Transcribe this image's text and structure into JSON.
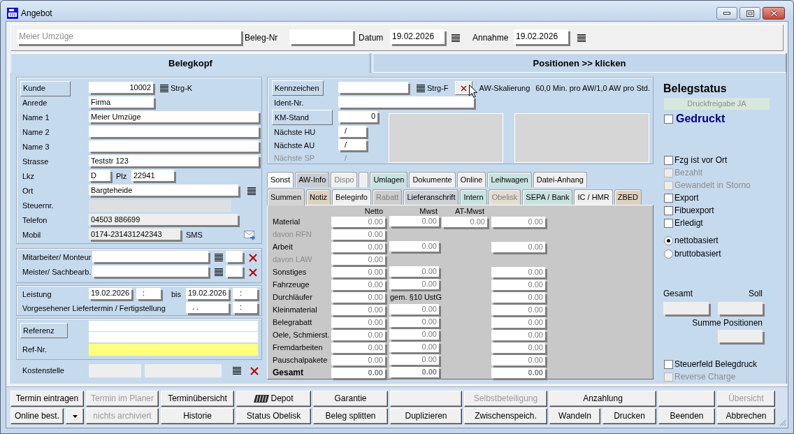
{
  "window": {
    "title": "Angebot"
  },
  "header": {
    "customer_name": {
      "value": "Meier Umzüge",
      "disabled": true
    },
    "beleg_nr": {
      "label": "Beleg-Nr"
    },
    "datum": {
      "label": "Datum",
      "value": "19.02.2026"
    },
    "annahme": {
      "label": "Annahme",
      "value": "19.02.2026"
    }
  },
  "main_tabs": [
    {
      "label": "Belegkopf",
      "selected": true
    },
    {
      "label": "Positionen >> klicken",
      "selected": false
    }
  ],
  "customer": {
    "kunde": {
      "button": "Kunde",
      "value": "10002",
      "shortcut": "Strg-K"
    },
    "anrede": {
      "label": "Anrede",
      "value": "Firma"
    },
    "name_1": {
      "label": "Name 1",
      "value": "Meier Umzüge"
    },
    "name_2": {
      "label": "Name 2"
    },
    "name_3": {
      "label": "Name 3"
    },
    "strasse": {
      "label": "Strasse",
      "value": "Teststr 123"
    },
    "lkz": {
      "label": "Lkz",
      "value": "D"
    },
    "plz": {
      "label": "Plz",
      "value": "22941"
    },
    "ort": {
      "label": "Ort",
      "value": "Bargteheide"
    },
    "steuernr": {
      "label": "Steuernr.",
      "disabled": true
    },
    "telefon": {
      "label": "Telefon",
      "value": "04503 886699",
      "readonly": true
    },
    "mobil": {
      "label": "Mobil",
      "value": "0174-231431242343",
      "readonly": true
    },
    "sms": "SMS"
  },
  "staff": [
    {
      "label": "Mitarbeiter/ Monteur"
    },
    {
      "label": "Meister/ Sachbearb."
    }
  ],
  "service_dates": {
    "leistung": {
      "label": "Leistung",
      "date": "19.02.2026",
      "time": ":"
    },
    "bis": {
      "label": "bis",
      "date": "19.02.2026",
      "time": ":"
    },
    "liefertermin": {
      "label": "Vorgesehener Liefertermin / Fertigstellung",
      "date": ". .",
      "time": ":"
    }
  },
  "reference": {
    "button": "Referenz",
    "ref_nr": {
      "label": "Ref-Nr.",
      "required": true
    }
  },
  "cost_center": {
    "label": "Kostenstelle",
    "fields": [
      {
        "readonly": true
      },
      {
        "readonly": true
      }
    ]
  },
  "vehicle": {
    "kennzeichen": {
      "button": "Kennzeichen",
      "shortcut": "Strg-F"
    },
    "aw_scaling": {
      "label": "AW-Skalierung",
      "value": "60,0 Min. pro AW/1,0 AW pro Std."
    },
    "ident_nr": {
      "label": "Ident-Nr."
    },
    "km_stand": {
      "button": "KM-Stand",
      "value": "0"
    },
    "naechste_hu": {
      "label": "Nächste HU",
      "value": "/"
    },
    "naechste_au": {
      "label": "Nächste AU",
      "value": "/"
    },
    "naechste_sp": {
      "label": "Nächste SP",
      "value": "/",
      "disabled": true
    }
  },
  "detail_tab_rows": [
    {
      "tabs": [
        {
          "label": "Sonst",
          "selected": false,
          "disabled": false,
          "color": "#fafafa"
        },
        {
          "label": "AW-Info",
          "selected": false,
          "disabled": false,
          "color": "#c9cdd1"
        },
        {
          "label": "Dispo",
          "selected": false,
          "disabled": true,
          "color": "#f0f0f0"
        },
        {
          "selected": false,
          "color": "#f0f0f0"
        },
        {
          "label": "Umlagen",
          "selected": false,
          "disabled": false,
          "color": "#c8e3e0"
        },
        {
          "label": "Dokumente",
          "selected": false,
          "disabled": false,
          "color": "#f0f0f0"
        },
        {
          "label": "Online",
          "selected": false,
          "disabled": false,
          "color": "#f0f0f0"
        },
        {
          "label": "Leihwagen",
          "selected": false,
          "disabled": false,
          "color": "#c8e3e0"
        },
        {
          "label": "Datei-Anhang",
          "selected": false,
          "disabled": false,
          "color": "#f0f0f0"
        }
      ]
    },
    {
      "tabs": [
        {
          "label": "Summen",
          "selected": true,
          "disabled": false,
          "color": "#d4d4d4"
        },
        {
          "label": "Notiz",
          "selected": false,
          "disabled": false,
          "color": "#ddd0bf"
        },
        {
          "label": "Beleginfo",
          "selected": false,
          "disabled": false,
          "color": "#f0f0f0"
        },
        {
          "label": "Rabatt",
          "selected": false,
          "disabled": true,
          "color": "#cdcdcd"
        },
        {
          "label": "Lieferanschrift",
          "selected": false,
          "disabled": false,
          "color": "#cdd1d5"
        },
        {
          "label": "Intern",
          "selected": false,
          "disabled": false,
          "color": "#c8e3e0"
        },
        {
          "label": "Obelisk",
          "selected": false,
          "disabled": true,
          "color": "#e3dcd0"
        },
        {
          "label": "SEPA / Bank",
          "selected": false,
          "disabled": false,
          "color": "#c8e3e0"
        },
        {
          "label": "IC / HMR",
          "selected": false,
          "disabled": false,
          "color": "#f0f0f0"
        },
        {
          "label": "ZBED",
          "selected": false,
          "disabled": false,
          "color": "#ddd0bf"
        }
      ]
    }
  ],
  "sums": {
    "columns": [
      "Netto",
      "Mwst",
      "AT-Mwst"
    ],
    "rows": [
      {
        "kind": "line",
        "label": "Material",
        "disabled": false,
        "netto": "0.00",
        "mwst": "0.00",
        "at_mwst": "0.00",
        "column_4": "0.00"
      },
      {
        "kind": "line",
        "label": "davon RFN",
        "disabled": true,
        "netto": "0.00"
      },
      {
        "kind": "line",
        "label": "Arbeit",
        "disabled": false,
        "netto": "0.00",
        "mwst": "0.00",
        "column_4": "0.00"
      },
      {
        "kind": "line",
        "label": "davon LAW",
        "disabled": true,
        "netto": "0.00"
      },
      {
        "kind": "line",
        "label": "Sonstiges",
        "disabled": false,
        "netto": "0.00",
        "mwst": "0.00",
        "column_4": "0.00"
      },
      {
        "kind": "line",
        "label": "Fahrzeuge",
        "disabled": false,
        "netto": "0.00",
        "mwst": "0.00",
        "column_4": "0.00"
      },
      {
        "kind": "line",
        "label": "Durchläufer",
        "disabled": false,
        "netto": "0.00",
        "mwst_note": "gem. §10 UstG",
        "column_4": "0.00"
      },
      {
        "kind": "line",
        "label": "Kleinmaterial",
        "disabled": false,
        "netto": "0.00",
        "mwst": "0.00",
        "column_4": "0.00"
      },
      {
        "kind": "line",
        "label": "Belegrabatt",
        "disabled": false,
        "netto": "0.00",
        "mwst": "0.00",
        "column_4": "0.00"
      },
      {
        "kind": "line",
        "label": "Oele, Schmierst.",
        "disabled": false,
        "netto": "0.00",
        "mwst": "0.00",
        "column_4": "0.00"
      },
      {
        "kind": "line",
        "label": "Fremdarbeiten",
        "disabled": false,
        "netto": "0.00",
        "mwst": "0.00",
        "column_4": "0.00"
      },
      {
        "kind": "line",
        "label": "Pauschalpakete",
        "disabled": false,
        "netto": "0.00",
        "mwst": "0.00",
        "column_4": "0.00"
      },
      {
        "kind": "total",
        "label": "Gesamt",
        "disabled": false,
        "netto": "0.00",
        "mwst": "0.00",
        "column_4": "0.00"
      }
    ]
  },
  "status": {
    "title": "Belegstatus",
    "print_release": "Druckfreigabe JA",
    "printed": {
      "label": "Gedruckt",
      "checked": false
    },
    "flags": [
      {
        "label": "Fzg ist vor Ort",
        "checked": false,
        "disabled": false
      },
      {
        "label": "Bezahlt",
        "checked": false,
        "disabled": true
      },
      {
        "label": "Gewandelt in Storno",
        "checked": false,
        "disabled": true
      },
      {
        "label": "Export",
        "checked": false,
        "disabled": false
      },
      {
        "label": "Fibuexport",
        "checked": false,
        "disabled": false
      },
      {
        "label": "Erledigt",
        "checked": false,
        "disabled": false
      }
    ],
    "basis": [
      {
        "label": "nettobasiert",
        "selected": true
      },
      {
        "label": "bruttobasiert",
        "selected": false
      }
    ],
    "totals": {
      "gesamt": {
        "label": "Gesamt",
        "readonly": true
      },
      "soll": {
        "label": "Soll",
        "readonly": true
      },
      "summe_positionen": {
        "label": "Summe Positionen",
        "readonly": true
      }
    },
    "options": [
      {
        "label": "Steuerfeld Belegdruck",
        "checked": false,
        "disabled": false
      },
      {
        "label": "Reverse Charge",
        "checked": false,
        "disabled": true
      }
    ]
  },
  "button_rows": [
    {
      "buttons": [
        {
          "kind": "text",
          "label": "Termin eintragen",
          "disabled": false
        },
        {
          "kind": "text",
          "label": "Termin im Planer",
          "disabled": true
        },
        {
          "kind": "text",
          "label": "Terminübersicht",
          "disabled": false
        },
        {
          "kind": "icon",
          "label": "Depot",
          "disabled": false
        },
        {
          "kind": "text",
          "label": "Garantie",
          "disabled": false
        },
        {
          "kind": "blank"
        },
        {
          "kind": "text",
          "label": "Selbstbeteiligung",
          "disabled": true
        },
        {
          "kind": "text",
          "label": "Anzahlung",
          "disabled": false
        },
        {
          "kind": "blank"
        },
        {
          "kind": "text",
          "label": "Übersicht",
          "disabled": true
        }
      ]
    },
    {
      "buttons": [
        {
          "kind": "text",
          "label": "Online best.",
          "disabled": false
        },
        {
          "kind": "dropdown"
        },
        {
          "kind": "text",
          "label": "nichts archiviert",
          "disabled": true
        },
        {
          "kind": "text",
          "label": "Historie",
          "disabled": false
        },
        {
          "kind": "text",
          "label": "Status Obelisk",
          "disabled": false
        },
        {
          "kind": "text",
          "label": "Beleg splitten",
          "disabled": false
        },
        {
          "kind": "text",
          "label": "Duplizieren",
          "disabled": false
        },
        {
          "kind": "text",
          "label": "Zwischenspeich.",
          "disabled": false
        },
        {
          "kind": "text",
          "label": "Wandeln",
          "disabled": false
        },
        {
          "kind": "text",
          "label": "Drucken",
          "disabled": false
        },
        {
          "kind": "text",
          "label": "Beenden",
          "disabled": false
        },
        {
          "kind": "text",
          "label": "Abbrechen",
          "disabled": false
        }
      ]
    }
  ]
}
